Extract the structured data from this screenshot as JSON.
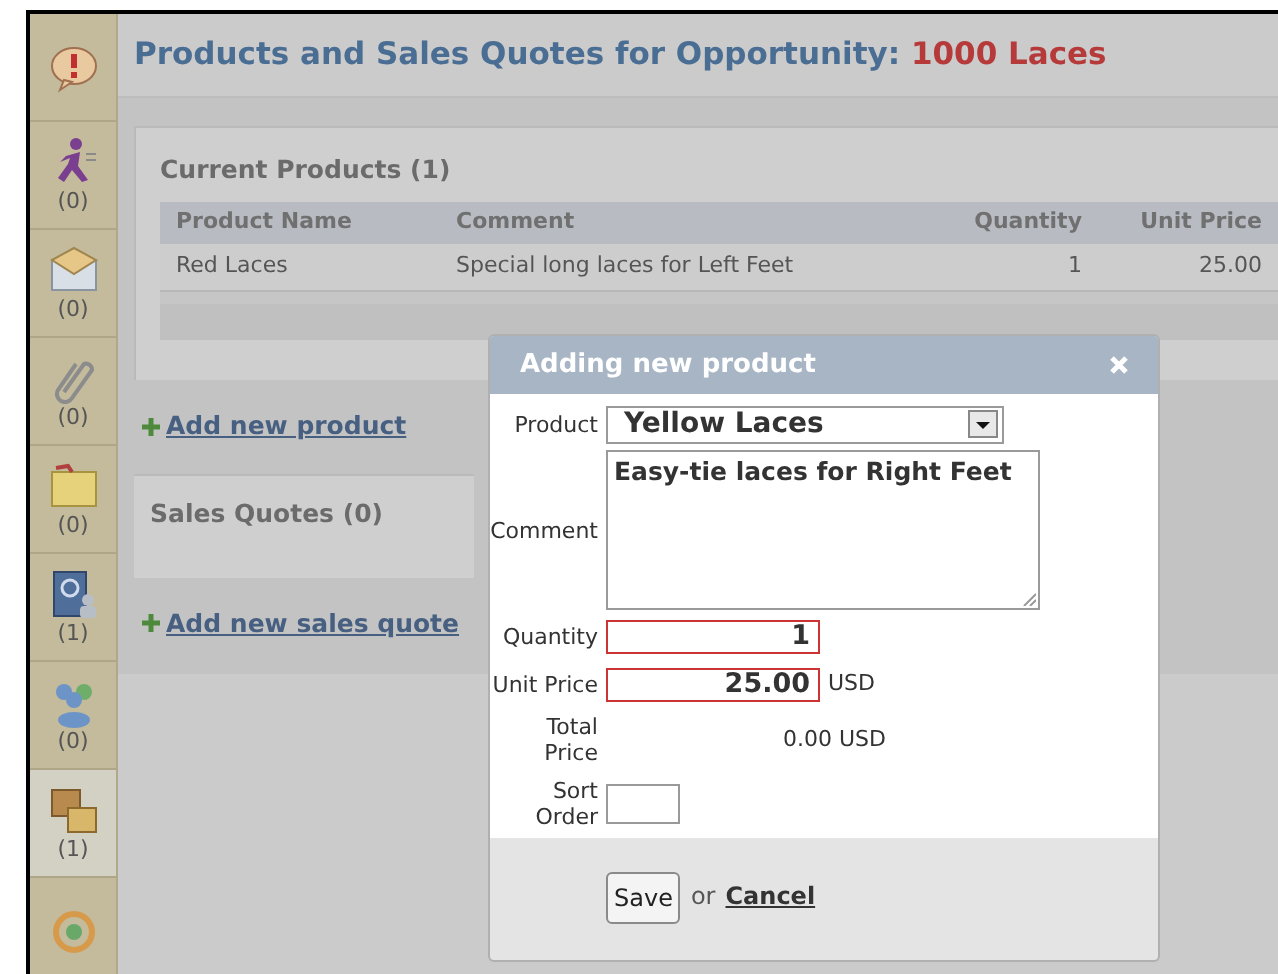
{
  "sidebar": {
    "items": [
      {
        "kind": "alert",
        "selected": false
      },
      {
        "kind": "runner",
        "count": "(0)",
        "selected": false
      },
      {
        "kind": "envelope",
        "count": "(0)",
        "selected": false
      },
      {
        "kind": "paperclip",
        "count": "(0)",
        "selected": false
      },
      {
        "kind": "folder",
        "count": "(0)",
        "selected": false
      },
      {
        "kind": "address_book",
        "count": "(1)",
        "selected": false
      },
      {
        "kind": "people",
        "count": "(0)",
        "selected": false
      },
      {
        "kind": "boxes",
        "count": "(1)",
        "selected": true
      },
      {
        "kind": "cycle",
        "selected": false
      }
    ]
  },
  "title": {
    "text": "Products and Sales Quotes for Opportunity:",
    "highlight": "1000 Laces"
  },
  "current_products": {
    "heading": "Current Products (1)",
    "table": {
      "columns": [
        "Product Name",
        "Comment",
        "Quantity",
        "Unit Price"
      ],
      "rows": [
        [
          "Red Laces",
          "Special long laces for Left Feet",
          "1",
          "25.00"
        ]
      ]
    },
    "add_link": "Add new product"
  },
  "sales_quotes": {
    "heading": "Sales Quotes (0)",
    "add_link": "Add new sales quote"
  },
  "dialog": {
    "title": "Adding new product",
    "fields": [
      {
        "kind": "select",
        "label": "Product",
        "value": "Yellow Laces"
      },
      {
        "kind": "textarea",
        "label": "Comment",
        "value": "Easy-tie laces for Right Feet"
      },
      {
        "kind": "input",
        "label": "Quantity",
        "value": "1",
        "invalid": true
      },
      {
        "kind": "input",
        "label": "Unit Price",
        "value": "25.00",
        "invalid": true,
        "unit": "USD"
      },
      {
        "kind": "static",
        "label": "Total Price",
        "value": "0.00 USD"
      },
      {
        "kind": "small_input",
        "label": "Sort Order",
        "invalid": false
      }
    ],
    "save": "Save",
    "or": "or",
    "cancel": "Cancel"
  }
}
